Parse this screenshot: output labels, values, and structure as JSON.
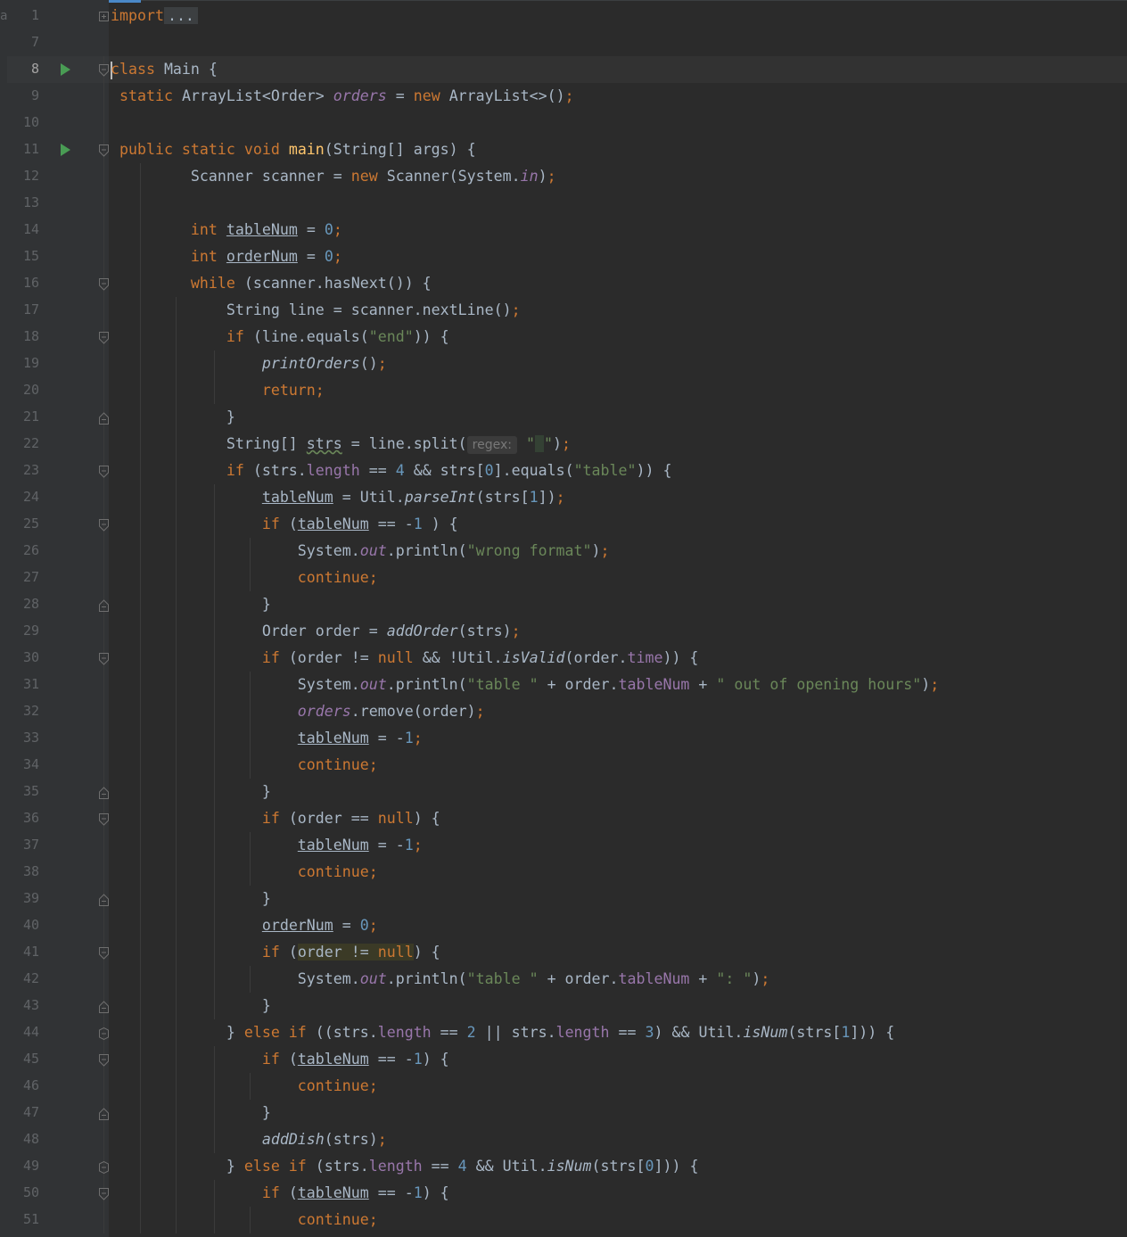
{
  "editor": {
    "left_strip_letter": "a",
    "caret_line": 8,
    "lines": [
      {
        "n": "1",
        "run": false,
        "fold": "plus"
      },
      {
        "n": "7",
        "run": false,
        "fold": ""
      },
      {
        "n": "8",
        "run": true,
        "fold": "open"
      },
      {
        "n": "9",
        "run": false,
        "fold": ""
      },
      {
        "n": "10",
        "run": false,
        "fold": ""
      },
      {
        "n": "11",
        "run": true,
        "fold": "open"
      },
      {
        "n": "12",
        "run": false,
        "fold": ""
      },
      {
        "n": "13",
        "run": false,
        "fold": ""
      },
      {
        "n": "14",
        "run": false,
        "fold": ""
      },
      {
        "n": "15",
        "run": false,
        "fold": ""
      },
      {
        "n": "16",
        "run": false,
        "fold": "open"
      },
      {
        "n": "17",
        "run": false,
        "fold": ""
      },
      {
        "n": "18",
        "run": false,
        "fold": "open"
      },
      {
        "n": "19",
        "run": false,
        "fold": ""
      },
      {
        "n": "20",
        "run": false,
        "fold": ""
      },
      {
        "n": "21",
        "run": false,
        "fold": "close"
      },
      {
        "n": "22",
        "run": false,
        "fold": ""
      },
      {
        "n": "23",
        "run": false,
        "fold": "open"
      },
      {
        "n": "24",
        "run": false,
        "fold": ""
      },
      {
        "n": "25",
        "run": false,
        "fold": "open"
      },
      {
        "n": "26",
        "run": false,
        "fold": ""
      },
      {
        "n": "27",
        "run": false,
        "fold": ""
      },
      {
        "n": "28",
        "run": false,
        "fold": "close"
      },
      {
        "n": "29",
        "run": false,
        "fold": ""
      },
      {
        "n": "30",
        "run": false,
        "fold": "open"
      },
      {
        "n": "31",
        "run": false,
        "fold": ""
      },
      {
        "n": "32",
        "run": false,
        "fold": ""
      },
      {
        "n": "33",
        "run": false,
        "fold": ""
      },
      {
        "n": "34",
        "run": false,
        "fold": ""
      },
      {
        "n": "35",
        "run": false,
        "fold": "close"
      },
      {
        "n": "36",
        "run": false,
        "fold": "open"
      },
      {
        "n": "37",
        "run": false,
        "fold": ""
      },
      {
        "n": "38",
        "run": false,
        "fold": ""
      },
      {
        "n": "39",
        "run": false,
        "fold": "close"
      },
      {
        "n": "40",
        "run": false,
        "fold": ""
      },
      {
        "n": "41",
        "run": false,
        "fold": "open"
      },
      {
        "n": "42",
        "run": false,
        "fold": ""
      },
      {
        "n": "43",
        "run": false,
        "fold": "close"
      },
      {
        "n": "44",
        "run": false,
        "fold": "both"
      },
      {
        "n": "45",
        "run": false,
        "fold": "open"
      },
      {
        "n": "46",
        "run": false,
        "fold": ""
      },
      {
        "n": "47",
        "run": false,
        "fold": "close"
      },
      {
        "n": "48",
        "run": false,
        "fold": ""
      },
      {
        "n": "49",
        "run": false,
        "fold": "both"
      },
      {
        "n": "50",
        "run": false,
        "fold": "open"
      },
      {
        "n": "51",
        "run": false,
        "fold": ""
      }
    ],
    "code": [
      [
        [
          "kw",
          "import"
        ],
        [
          "",
          ""
        ],
        [
          "fold-pill",
          "..."
        ]
      ],
      [],
      [
        [
          "caret",
          ""
        ],
        [
          "kw",
          "class"
        ],
        [
          "",
          " Main {"
        ]
      ],
      [
        [
          "",
          " "
        ],
        [
          "kw",
          "static"
        ],
        [
          "",
          " ArrayList<Order> "
        ],
        [
          "sfield",
          "orders"
        ],
        [
          "",
          " = "
        ],
        [
          "kw",
          "new"
        ],
        [
          "",
          " ArrayList<>()"
        ],
        [
          "kw",
          ";"
        ]
      ],
      [],
      [
        [
          "",
          " "
        ],
        [
          "kw",
          "public static void"
        ],
        [
          "",
          " "
        ],
        [
          "meth-decl",
          "main"
        ],
        [
          "",
          "(String[] args) {"
        ]
      ],
      [
        [
          "",
          "         Scanner scanner = "
        ],
        [
          "kw",
          "new"
        ],
        [
          "",
          " Scanner(System."
        ],
        [
          "sfield",
          "in"
        ],
        [
          "",
          ")"
        ],
        [
          "kw",
          ";"
        ]
      ],
      [],
      [
        [
          "",
          "         "
        ],
        [
          "kw",
          "int"
        ],
        [
          "",
          " "
        ],
        [
          "var-mod",
          "tableNum"
        ],
        [
          "",
          " = "
        ],
        [
          "num",
          "0"
        ],
        [
          "kw",
          ";"
        ]
      ],
      [
        [
          "",
          "         "
        ],
        [
          "kw",
          "int"
        ],
        [
          "",
          " "
        ],
        [
          "var-mod",
          "orderNum"
        ],
        [
          "",
          " = "
        ],
        [
          "num",
          "0"
        ],
        [
          "kw",
          ";"
        ]
      ],
      [
        [
          "",
          "         "
        ],
        [
          "kw",
          "while"
        ],
        [
          "",
          " (scanner.hasNext()) {"
        ]
      ],
      [
        [
          "",
          "             String line = scanner.nextLine()"
        ],
        [
          "kw",
          ";"
        ]
      ],
      [
        [
          "",
          "             "
        ],
        [
          "kw",
          "if"
        ],
        [
          "",
          " (line.equals("
        ],
        [
          "str",
          "\"end\""
        ],
        [
          "",
          "))"
        ],
        [
          "",
          " {"
        ]
      ],
      [
        [
          "",
          "                 "
        ],
        [
          "smeth",
          "printOrders"
        ],
        [
          "",
          "()"
        ],
        [
          "kw",
          ";"
        ]
      ],
      [
        [
          "",
          "                 "
        ],
        [
          "kw",
          "return;"
        ]
      ],
      [
        [
          "",
          "             }"
        ]
      ],
      [
        [
          "",
          "             String[] "
        ],
        [
          "squiggle",
          "strs"
        ],
        [
          "",
          " = line.split("
        ],
        [
          "hint",
          "regex:"
        ],
        [
          "",
          " "
        ],
        [
          "str",
          "\""
        ],
        [
          "space-hl",
          " "
        ],
        [
          "str",
          "\""
        ],
        [
          "",
          ")"
        ],
        [
          "kw",
          ";"
        ]
      ],
      [
        [
          "",
          "             "
        ],
        [
          "kw",
          "if"
        ],
        [
          "",
          " (strs."
        ],
        [
          "field",
          "length"
        ],
        [
          "",
          " == "
        ],
        [
          "num",
          "4"
        ],
        [
          "",
          " && strs["
        ],
        [
          "num",
          "0"
        ],
        [
          "",
          "].equals("
        ],
        [
          "str",
          "\"table\""
        ],
        [
          "",
          ")) {"
        ]
      ],
      [
        [
          "",
          "                 "
        ],
        [
          "var-mod",
          "tableNum"
        ],
        [
          "",
          " = Util."
        ],
        [
          "smeth",
          "parseInt"
        ],
        [
          "",
          "(strs["
        ],
        [
          "num",
          "1"
        ],
        [
          "",
          "])"
        ],
        [
          "kw",
          ";"
        ]
      ],
      [
        [
          "",
          "                 "
        ],
        [
          "kw",
          "if"
        ],
        [
          "",
          " ("
        ],
        [
          "var-mod",
          "tableNum"
        ],
        [
          "",
          " == -"
        ],
        [
          "num",
          "1"
        ],
        [
          "",
          " ) {"
        ]
      ],
      [
        [
          "",
          "                     System."
        ],
        [
          "sfield",
          "out"
        ],
        [
          "",
          ".println("
        ],
        [
          "str",
          "\"wrong format\""
        ],
        [
          "",
          ")"
        ],
        [
          "kw",
          ";"
        ]
      ],
      [
        [
          "",
          "                     "
        ],
        [
          "kw",
          "continue;"
        ]
      ],
      [
        [
          "",
          "                 }"
        ]
      ],
      [
        [
          "",
          "                 Order order = "
        ],
        [
          "smeth",
          "addOrder"
        ],
        [
          "",
          "(strs)"
        ],
        [
          "kw",
          ";"
        ]
      ],
      [
        [
          "",
          "                 "
        ],
        [
          "kw",
          "if"
        ],
        [
          "",
          " (order != "
        ],
        [
          "kw",
          "null"
        ],
        [
          "",
          " && !Util."
        ],
        [
          "smeth",
          "isValid"
        ],
        [
          "",
          "(order."
        ],
        [
          "field",
          "time"
        ],
        [
          "",
          ")) {"
        ]
      ],
      [
        [
          "",
          "                     System."
        ],
        [
          "sfield",
          "out"
        ],
        [
          "",
          ".println("
        ],
        [
          "str",
          "\"table \""
        ],
        [
          "",
          " + order."
        ],
        [
          "field",
          "tableNum"
        ],
        [
          "",
          " + "
        ],
        [
          "str",
          "\" out of opening hours\""
        ],
        [
          "",
          ")"
        ],
        [
          "kw",
          ";"
        ]
      ],
      [
        [
          "",
          "                     "
        ],
        [
          "sfield",
          "orders"
        ],
        [
          "",
          ".remove(order)"
        ],
        [
          "kw",
          ";"
        ]
      ],
      [
        [
          "",
          "                     "
        ],
        [
          "var-mod",
          "tableNum"
        ],
        [
          "",
          " = -"
        ],
        [
          "num",
          "1"
        ],
        [
          "kw",
          ";"
        ]
      ],
      [
        [
          "",
          "                     "
        ],
        [
          "kw",
          "continue;"
        ]
      ],
      [
        [
          "",
          "                 }"
        ]
      ],
      [
        [
          "",
          "                 "
        ],
        [
          "kw",
          "if"
        ],
        [
          "",
          " (order == "
        ],
        [
          "kw",
          "null"
        ],
        [
          "",
          ") {"
        ]
      ],
      [
        [
          "",
          "                     "
        ],
        [
          "var-mod",
          "tableNum"
        ],
        [
          "",
          " = -"
        ],
        [
          "num",
          "1"
        ],
        [
          "kw",
          ";"
        ]
      ],
      [
        [
          "",
          "                     "
        ],
        [
          "kw",
          "continue;"
        ]
      ],
      [
        [
          "",
          "                 }"
        ]
      ],
      [
        [
          "",
          "                 "
        ],
        [
          "var-mod",
          "orderNum"
        ],
        [
          "",
          " = "
        ],
        [
          "num",
          "0"
        ],
        [
          "kw",
          ";"
        ]
      ],
      [
        [
          "",
          "                 "
        ],
        [
          "kw",
          "if"
        ],
        [
          "",
          " ("
        ],
        [
          "highlight",
          "order != "
        ],
        [
          "highlight-kw",
          "null"
        ],
        [
          "",
          ") {"
        ]
      ],
      [
        [
          "",
          "                     System."
        ],
        [
          "sfield",
          "out"
        ],
        [
          "",
          ".println("
        ],
        [
          "str",
          "\"table \""
        ],
        [
          "",
          " + order."
        ],
        [
          "field",
          "tableNum"
        ],
        [
          "",
          " + "
        ],
        [
          "str",
          "\": \""
        ],
        [
          "",
          ")"
        ],
        [
          "kw",
          ";"
        ]
      ],
      [
        [
          "",
          "                 }"
        ]
      ],
      [
        [
          "",
          "             } "
        ],
        [
          "kw",
          "else if"
        ],
        [
          "",
          " ((strs."
        ],
        [
          "field",
          "length"
        ],
        [
          "",
          " == "
        ],
        [
          "num",
          "2"
        ],
        [
          "",
          " || strs."
        ],
        [
          "field",
          "length"
        ],
        [
          "",
          " == "
        ],
        [
          "num",
          "3"
        ],
        [
          "",
          ") && Util."
        ],
        [
          "smeth",
          "isNum"
        ],
        [
          "",
          "(strs["
        ],
        [
          "num",
          "1"
        ],
        [
          "",
          "])) {"
        ]
      ],
      [
        [
          "",
          "                 "
        ],
        [
          "kw",
          "if"
        ],
        [
          "",
          " ("
        ],
        [
          "var-mod",
          "tableNum"
        ],
        [
          "",
          " == -"
        ],
        [
          "num",
          "1"
        ],
        [
          "",
          ") {"
        ]
      ],
      [
        [
          "",
          "                     "
        ],
        [
          "kw",
          "continue;"
        ]
      ],
      [
        [
          "",
          "                 }"
        ]
      ],
      [
        [
          "",
          "                 "
        ],
        [
          "smeth",
          "addDish"
        ],
        [
          "",
          "(strs)"
        ],
        [
          "kw",
          ";"
        ]
      ],
      [
        [
          "",
          "             } "
        ],
        [
          "kw",
          "else if"
        ],
        [
          "",
          " (strs."
        ],
        [
          "field",
          "length"
        ],
        [
          "",
          " == "
        ],
        [
          "num",
          "4"
        ],
        [
          "",
          " && Util."
        ],
        [
          "smeth",
          "isNum"
        ],
        [
          "",
          "(strs["
        ],
        [
          "num",
          "0"
        ],
        [
          "",
          "])) {"
        ]
      ],
      [
        [
          "",
          "                 "
        ],
        [
          "kw",
          "if"
        ],
        [
          "",
          " ("
        ],
        [
          "var-mod",
          "tableNum"
        ],
        [
          "",
          " == -"
        ],
        [
          "num",
          "1"
        ],
        [
          "",
          ") {"
        ]
      ],
      [
        [
          "",
          "                     "
        ],
        [
          "kw",
          "continue;"
        ]
      ]
    ]
  }
}
